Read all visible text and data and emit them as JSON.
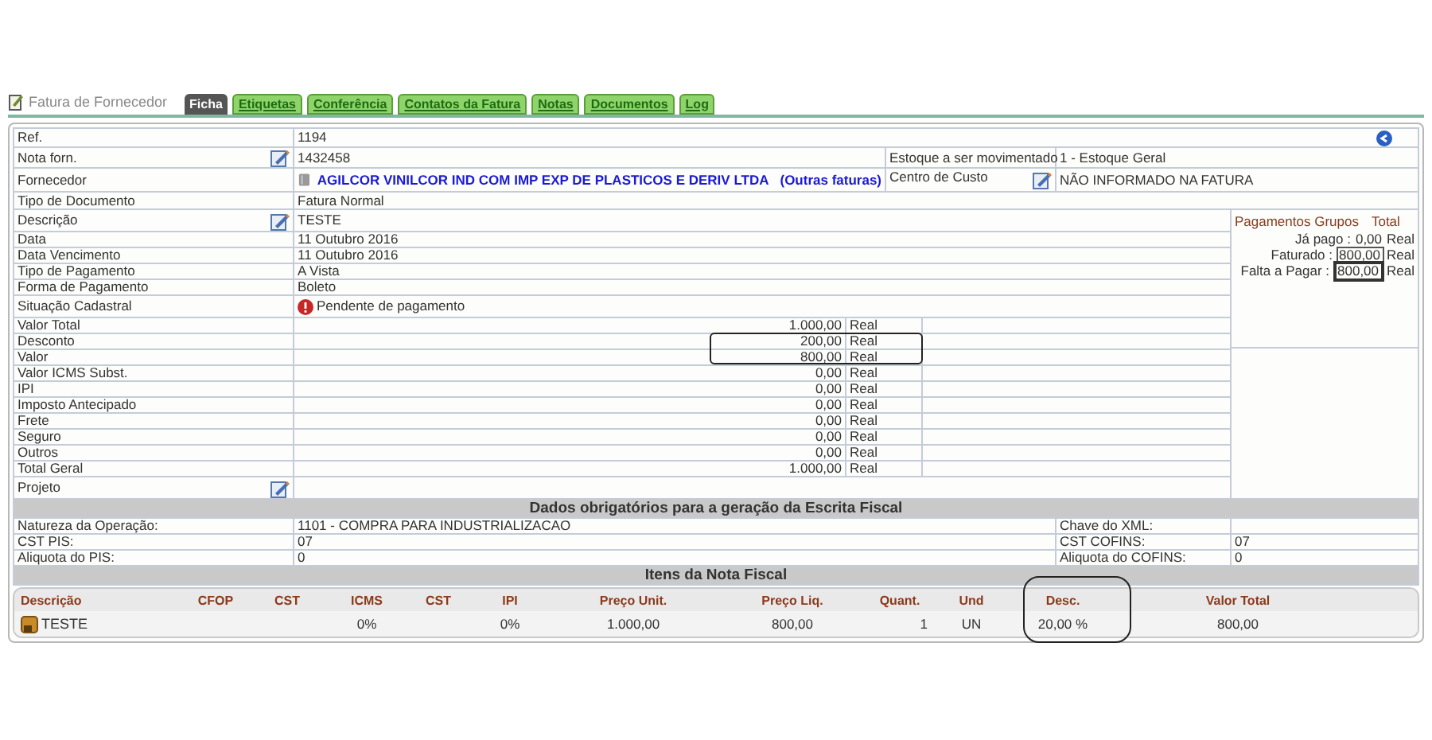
{
  "header": {
    "title": "Fatura de Fornecedor"
  },
  "tabs": [
    {
      "label": "Ficha",
      "selected": true
    },
    {
      "label": "Etiquetas",
      "selected": false
    },
    {
      "label": "Conferência",
      "selected": false
    },
    {
      "label": "Contatos da Fatura",
      "selected": false
    },
    {
      "label": "Notas",
      "selected": false
    },
    {
      "label": "Documentos",
      "selected": false
    },
    {
      "label": "Log",
      "selected": false
    }
  ],
  "ref": {
    "label": "Ref.",
    "value": "1194"
  },
  "top_rows": [
    {
      "label": "Nota forn.",
      "value": "1432458",
      "editable": true,
      "kind": "text",
      "right_label": "Estoque a ser movimentado",
      "right_value": "1 - Estoque Geral",
      "right_editable": false
    },
    {
      "label": "Fornecedor",
      "value": "AGILCOR VINILCOR IND COM IMP EXP DE PLASTICOS E DERIV LTDA",
      "link": "(Outras faturas)",
      "editable": false,
      "kind": "supplier",
      "right_label": "Centro de Custo",
      "right_value": "NÃO INFORMADO NA FATURA",
      "right_editable": true
    },
    {
      "label": "Tipo de Documento",
      "value": "Fatura Normal",
      "editable": false,
      "kind": "text"
    }
  ],
  "detail_rows": [
    {
      "label": "Descrição",
      "value": "TESTE",
      "editable": true,
      "kind": "text"
    },
    {
      "label": "Data",
      "value": "11 Outubro 2016",
      "editable": false,
      "kind": "text"
    },
    {
      "label": "Data Vencimento",
      "value": "11 Outubro 2016",
      "editable": false,
      "kind": "text"
    },
    {
      "label": "Tipo de Pagamento",
      "value": "A Vista",
      "editable": false,
      "kind": "text"
    },
    {
      "label": "Forma de Pagamento",
      "value": "Boleto",
      "editable": false,
      "kind": "text"
    },
    {
      "label": "Situação Cadastral",
      "value": "Pendente de pagamento",
      "editable": false,
      "kind": "status"
    }
  ],
  "money_rows": [
    {
      "label": "Valor Total",
      "value": "1.000,00",
      "currency": "Real"
    },
    {
      "label": "Desconto",
      "value": "200,00",
      "currency": "Real"
    },
    {
      "label": "Valor",
      "value": "800,00",
      "currency": "Real"
    },
    {
      "label": "Valor ICMS Subst.",
      "value": "0,00",
      "currency": "Real"
    },
    {
      "label": "IPI",
      "value": "0,00",
      "currency": "Real"
    },
    {
      "label": "Imposto Antecipado",
      "value": "0,00",
      "currency": "Real"
    },
    {
      "label": "Frete",
      "value": "0,00",
      "currency": "Real"
    },
    {
      "label": "Seguro",
      "value": "0,00",
      "currency": "Real"
    },
    {
      "label": "Outros",
      "value": "0,00",
      "currency": "Real"
    },
    {
      "label": "Total Geral",
      "value": "1.000,00",
      "currency": "Real"
    }
  ],
  "project": {
    "label": "Projeto",
    "editable": true
  },
  "payments": {
    "title": "Pagamentos Grupos",
    "total_header": "Total",
    "rows": [
      {
        "label": "Já pago :",
        "value": "0,00",
        "currency": "Real",
        "kind": "plain"
      },
      {
        "label": "Faturado :",
        "value": "800,00",
        "currency": "Real",
        "kind": "boxed"
      },
      {
        "label": "Falta a Pagar :",
        "value": "800,00",
        "currency": "Real",
        "kind": "boxed_bold"
      }
    ]
  },
  "fiscal": {
    "title": "Dados obrigatórios para a geração da Escrita Fiscal",
    "rows": [
      {
        "label": "Natureza da Operação:",
        "value": "1101 - COMPRA PARA INDUSTRIALIZACAO",
        "right_label": "Chave do XML:"
      },
      {
        "label": "CST PIS:",
        "value": "07",
        "right_label": "CST COFINS:",
        "right_value": "07"
      },
      {
        "label": "Aliquota do PIS:",
        "value": "0",
        "right_label": "Aliquota do COFINS:",
        "right_value": "0"
      }
    ]
  },
  "items": {
    "title": "Itens da Nota Fiscal",
    "columns": [
      "Descrição",
      "CFOP",
      "CST",
      "ICMS",
      "CST",
      "IPI",
      "Preço Unit.",
      "Preço Liq.",
      "Quant.",
      "Und",
      "Desc.",
      "Valor Total"
    ],
    "rows": [
      {
        "cells": [
          "TESTE",
          null,
          null,
          "0%",
          null,
          "0%",
          "1.000,00",
          "800,00",
          "1",
          "UN",
          "20,00 %",
          "800,00"
        ]
      }
    ]
  }
}
